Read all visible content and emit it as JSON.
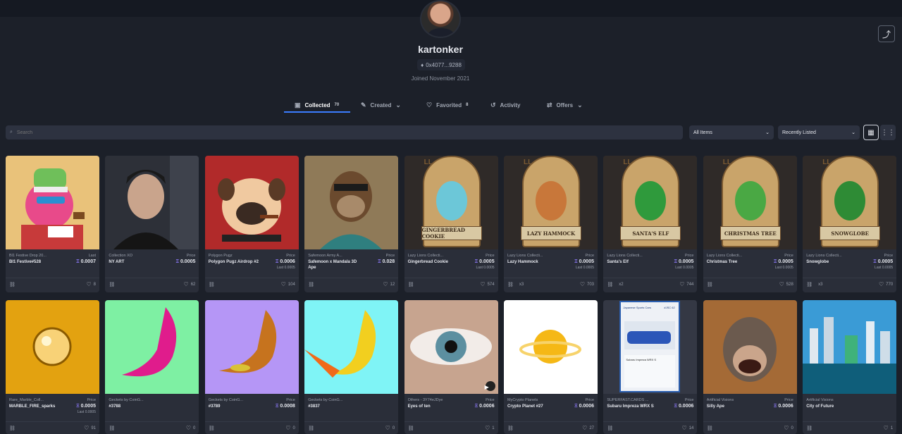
{
  "profile": {
    "username": "kartonker",
    "address": "0x4077...9288",
    "joined": "Joined November 2021"
  },
  "tabs": [
    {
      "label": "Collected",
      "count": "70",
      "icon": "collection-icon"
    },
    {
      "label": "Created",
      "icon": "brush-icon"
    },
    {
      "label": "Favorited",
      "count": "8",
      "icon": "heart-icon"
    },
    {
      "label": "Activity",
      "icon": "history-icon"
    },
    {
      "label": "Offers",
      "icon": "offers-icon"
    }
  ],
  "search": {
    "placeholder": "Search"
  },
  "filters": {
    "items": "All Items",
    "sort": "Recently Listed"
  },
  "colors": {
    "accent": "#3b7cff",
    "eth": "#8f7cff",
    "background": "#1c2029",
    "card": "#2a2e39"
  },
  "cards": [
    {
      "collection": "Bl1 Festive Drop 20...",
      "name": "Bl1 Festive#528",
      "price_label": "Last",
      "price": "0.0007",
      "last": "",
      "links": "",
      "likes": "8"
    },
    {
      "collection": "Collection XO",
      "name": "NY ART",
      "price_label": "Price",
      "price": "0.0005",
      "last": "",
      "links": "",
      "likes": "62"
    },
    {
      "collection": "Polygon Pugz",
      "name": "Polygon Pugz Airdrop #2",
      "price_label": "Price",
      "price": "0.0006",
      "last": "Last 0.0005",
      "links": "",
      "likes": "104"
    },
    {
      "collection": "Safemoon Army A...",
      "name": "Safemoon x Mandala 3D Ape",
      "price_label": "Price",
      "price": "0.028",
      "last": "",
      "links": "",
      "likes": "12"
    },
    {
      "collection": "Lazy Lions Collecti...",
      "name": "Gingerbread Cookie",
      "price_label": "Price",
      "price": "0.0005",
      "last": "Last 0.0005",
      "links": "",
      "likes": "574",
      "banner": "GINGERBREAD COOKIE"
    },
    {
      "collection": "Lazy Lions Collecti...",
      "name": "Lazy Hammock",
      "price_label": "Price",
      "price": "0.0005",
      "last": "Last 0.0005",
      "links": "x3",
      "likes": "703",
      "banner": "LAZY HAMMOCK"
    },
    {
      "collection": "Lazy Lions Collecti...",
      "name": "Santa's Elf",
      "price_label": "Price",
      "price": "0.0005",
      "last": "Last 0.0005",
      "links": "x2",
      "likes": "744",
      "banner": "SANTA'S ELF"
    },
    {
      "collection": "Lazy Lions Collecti...",
      "name": "Christmas Tree",
      "price_label": "Price",
      "price": "0.0005",
      "last": "Last 0.0005",
      "links": "",
      "likes": "528",
      "banner": "CHRISTMAS TREE"
    },
    {
      "collection": "Lazy Lions Collecti...",
      "name": "Snowglobe",
      "price_label": "Price",
      "price": "0.0005",
      "last": "Last 0.0005",
      "links": "x3",
      "likes": "770",
      "banner": "SNOWGLOBE"
    },
    {
      "collection": "Rare_Marble_Coll...",
      "name": "MARBLE_FIRE_sparks",
      "price_label": "Price",
      "price": "0.0005",
      "last": "Last 0.0005",
      "links": "",
      "likes": "91"
    },
    {
      "collection": "Geckets by CoinG...",
      "name": "#3788",
      "price_label": "",
      "price": "",
      "last": "",
      "links": "",
      "likes": "0"
    },
    {
      "collection": "Geckets by CoinG...",
      "name": "#3789",
      "price_label": "Price",
      "price": "0.0008",
      "last": "",
      "links": "",
      "likes": "0"
    },
    {
      "collection": "Geckets by CoinG...",
      "name": "#3837",
      "price_label": "",
      "price": "",
      "last": "",
      "links": "",
      "likes": "0"
    },
    {
      "collection": "Others - 3Y74eJDye",
      "name": "Eyes of ten",
      "price_label": "Price",
      "price": "0.0006",
      "last": "",
      "links": "",
      "likes": "1"
    },
    {
      "collection": "MyCrypto Planets",
      "name": "Crypto Planet #27",
      "price_label": "Price",
      "price": "0.0006",
      "last": "",
      "links": "",
      "likes": "27"
    },
    {
      "collection": "SUPERFAST.CARDS ...",
      "name": "Subaru Impreza WRX S",
      "price_label": "Price",
      "price": "0.0006",
      "last": "",
      "links": "",
      "likes": "14"
    },
    {
      "collection": "Artificial Visions",
      "name": "Silly Ape",
      "price_label": "Price",
      "price": "0.0006",
      "last": "",
      "links": "",
      "likes": "0"
    },
    {
      "collection": "Artificial Visions",
      "name": "City of Future",
      "price_label": "",
      "price": "",
      "last": "",
      "links": "",
      "likes": "1"
    }
  ],
  "car_card": {
    "title": "Japanese Sports Cars",
    "number": "#JSC 62",
    "caption": "Subaru Impreza WRX S"
  },
  "eth_symbol": "Ξ"
}
